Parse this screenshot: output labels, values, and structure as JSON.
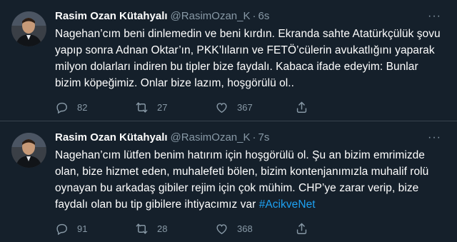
{
  "tweets": [
    {
      "name": "Rasim Ozan Kütahyalı",
      "handle": "@RasimOzan_K",
      "separator": "·",
      "time": "6s",
      "text": "Nagehan’cım beni dinlemedin ve beni kırdın. Ekranda sahte Atatürkçülük şovu yapıp sonra Adnan Oktar’ın, PKK’lıların ve FETÖ’cülerin avukatlığını yaparak milyon dolarları indiren bu tipler bize faydalı. Kabaca ifade edeyim: Bunlar bizim köpeğimiz. Onlar bize lazım, hoşgörülü ol..",
      "hashtag": "",
      "replies": "82",
      "retweets": "27",
      "likes": "367"
    },
    {
      "name": "Rasim Ozan Kütahyalı",
      "handle": "@RasimOzan_K",
      "separator": "·",
      "time": "7s",
      "text": "Nagehan’cım lütfen benim hatırım için hoşgörülü ol. Şu an bizim emrimizde olan, bize hizmet eden, muhalefeti bölen, bizim kontenjanımızla muhalif rolü oynayan bu arkadaş gibiler rejim için çok mühim. CHP’ye zarar verip, bize faydalı olan bu tip gibilere ihtiyacımız var ",
      "hashtag": "#AcikveNet",
      "replies": "91",
      "retweets": "28",
      "likes": "368"
    }
  ],
  "icons": {
    "more": "more-icon",
    "reply": "reply-icon",
    "retweet": "retweet-icon",
    "like": "heart-icon",
    "share": "share-icon"
  },
  "colors": {
    "background": "#15202b",
    "secondary_text": "#8899a6",
    "link": "#1da1f2",
    "divider": "#38444d"
  }
}
